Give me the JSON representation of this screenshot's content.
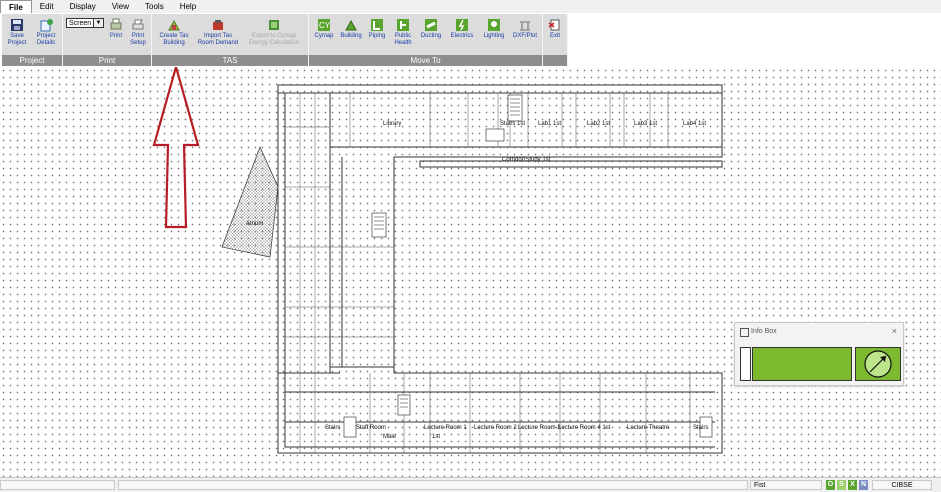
{
  "menu": [
    "File",
    "Edit",
    "Display",
    "View",
    "Tools",
    "Help"
  ],
  "ribbon": {
    "project": {
      "title": "Project",
      "save": "Save Project",
      "details": "Project Details"
    },
    "print": {
      "title": "Print",
      "screen_select": "Screen",
      "print": "Print",
      "setup": "Print Setup"
    },
    "tas": {
      "title": "TAS",
      "create": "Create Tas Building",
      "import": "Import Tas Room Demand",
      "export": "Export to Cymap Energy Calculation"
    },
    "moveto": {
      "title": "Move To",
      "items": [
        "Cymap",
        "Building",
        "Piping",
        "Public Health",
        "Ducting",
        "Electrics",
        "Lighting",
        "DXF/Plot"
      ]
    },
    "exit": "Exit"
  },
  "rooms": {
    "library": "Library",
    "stairs_1st_top": "Stairs 1st",
    "lab1": "Lab1 1st",
    "lab2": "Lab2 1st",
    "lab3": "Lab3 1st",
    "lab4": "Lab4 1st",
    "corridor": "Corridor/Study 1st",
    "atrium": "Atrium",
    "stairs_left": "Stairs",
    "staff_room": "Staff Room",
    "male": "Male",
    "t1st": "1st",
    "lecture1": "Lecture Room 1",
    "lecture2": "Lecture Room 2",
    "lecture3": "Lecture Room 3",
    "lecture4": "Lecture Room 4 1st",
    "lecture_theatre": "Lecture Theatre",
    "stairs_right": "Stairs"
  },
  "info_box": {
    "title": "Info Box",
    "close": "×",
    "color": "#7cb92e"
  },
  "status": {
    "floor": "Fist",
    "standard": "CIBSE",
    "badges": [
      "O",
      "S",
      "X",
      "N"
    ]
  },
  "colors": {
    "ribbon_group": "#dcdcdc",
    "group_title": "#8e8e8e",
    "arrow": "#b81d25",
    "info_green": "#7cb92e"
  }
}
